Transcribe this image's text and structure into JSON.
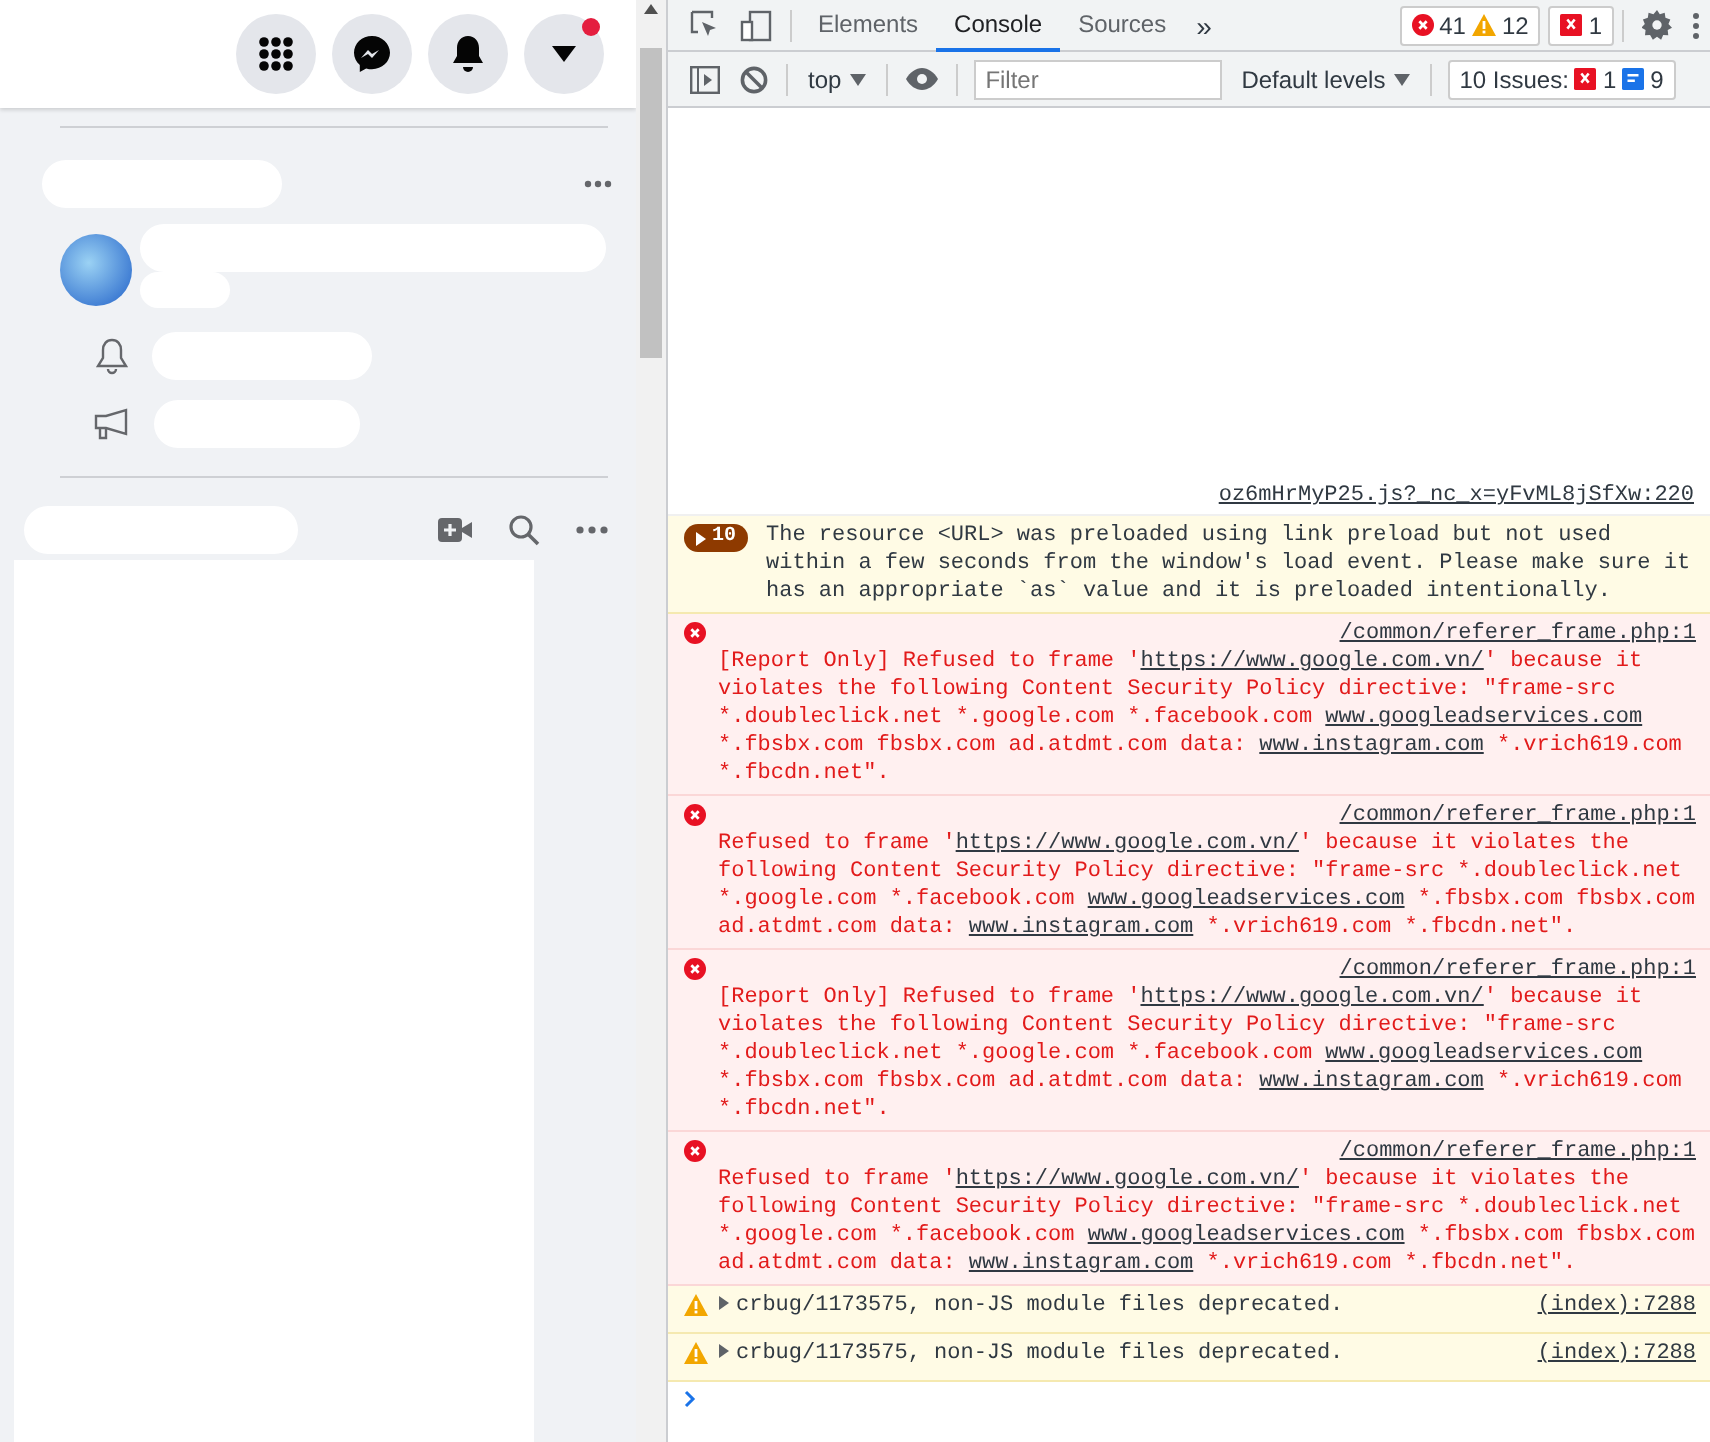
{
  "devtools": {
    "tabs": [
      {
        "label": "Elements",
        "selected": false
      },
      {
        "label": "Console",
        "selected": true
      },
      {
        "label": "Sources",
        "selected": false
      }
    ],
    "more_tabs": "»",
    "counters": {
      "errors": "41",
      "warnings": "12",
      "issues": "1"
    },
    "console_toolbar": {
      "context": "top",
      "filter": {
        "placeholder": "Filter"
      },
      "levels": "Default levels",
      "issues_label": "10 Issues:",
      "issues_errors": "1",
      "issues_info": "9"
    },
    "top_source": "oz6mHrMyP25.js?_nc_x=yFvML8jSfXw:220",
    "messages": [
      {
        "kind": "group",
        "count": "10",
        "parts": [
          {
            "text": "The resource <URL> was preloaded using link preload but not used within a few seconds from the window's load event. Please make sure it has an appropriate `as` value and it is preloaded intentionally.",
            "link": false
          }
        ]
      },
      {
        "kind": "error",
        "source": "/common/referer_frame.php:1",
        "parts": [
          {
            "text": "[Report Only] Refused to frame '",
            "link": false
          },
          {
            "text": "https://www.google.com.vn/",
            "link": true
          },
          {
            "text": "' because it violates the following Content Security Policy directive: \"frame-src *.doubleclick.net *.google.com *.facebook.com ",
            "link": false
          },
          {
            "text": "www.googleadservices.com",
            "link": true
          },
          {
            "text": " *.fbsbx.com fbsbx.com ad.atdmt.com data: ",
            "link": false
          },
          {
            "text": "www.instagram.com",
            "link": true
          },
          {
            "text": " *.vrich619.com *.fbcdn.net\".",
            "link": false
          }
        ]
      },
      {
        "kind": "error",
        "source": "/common/referer_frame.php:1",
        "parts": [
          {
            "text": "Refused to frame '",
            "link": false
          },
          {
            "text": "https://www.google.com.vn/",
            "link": true
          },
          {
            "text": "' because it violates the following Content Security Policy directive: \"frame-src *.doubleclick.net *.google.com *.facebook.com ",
            "link": false
          },
          {
            "text": "www.googleadservices.com",
            "link": true
          },
          {
            "text": " *.fbsbx.com fbsbx.com ad.atdmt.com data: ",
            "link": false
          },
          {
            "text": "www.instagram.com",
            "link": true
          },
          {
            "text": " *.vrich619.com *.fbcdn.net\".",
            "link": false
          }
        ]
      },
      {
        "kind": "error",
        "source": "/common/referer_frame.php:1",
        "parts": [
          {
            "text": "[Report Only] Refused to frame '",
            "link": false
          },
          {
            "text": "https://www.google.com.vn/",
            "link": true
          },
          {
            "text": "' because it violates the following Content Security Policy directive: \"frame-src *.doubleclick.net *.google.com *.facebook.com ",
            "link": false
          },
          {
            "text": "www.googleadservices.com",
            "link": true
          },
          {
            "text": " *.fbsbx.com fbsbx.com ad.atdmt.com data: ",
            "link": false
          },
          {
            "text": "www.instagram.com",
            "link": true
          },
          {
            "text": " *.vrich619.com *.fbcdn.net\".",
            "link": false
          }
        ]
      },
      {
        "kind": "error",
        "source": "/common/referer_frame.php:1",
        "parts": [
          {
            "text": "Refused to frame '",
            "link": false
          },
          {
            "text": "https://www.google.com.vn/",
            "link": true
          },
          {
            "text": "' because it violates the following Content Security Policy directive: \"frame-src *.doubleclick.net *.google.com *.facebook.com ",
            "link": false
          },
          {
            "text": "www.googleadservices.com",
            "link": true
          },
          {
            "text": " *.fbsbx.com fbsbx.com ad.atdmt.com data: ",
            "link": false
          },
          {
            "text": "www.instagram.com",
            "link": true
          },
          {
            "text": " *.vrich619.com *.fbcdn.net\".",
            "link": false
          }
        ]
      },
      {
        "kind": "warning",
        "source": "(index):7288",
        "parts": [
          {
            "text": "crbug/1173575, non-JS module files deprecated.",
            "link": false
          }
        ]
      },
      {
        "kind": "warning",
        "source": "(index):7288",
        "parts": [
          {
            "text": "crbug/1173575, non-JS module files deprecated.",
            "link": false
          }
        ]
      }
    ]
  }
}
